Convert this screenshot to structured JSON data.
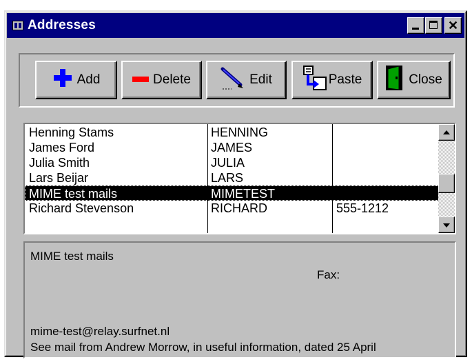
{
  "window": {
    "title": "Addresses",
    "controls": [
      "minimize",
      "maximize",
      "close"
    ]
  },
  "toolbar": {
    "add_label": "Add",
    "delete_label": "Delete",
    "edit_label": "Edit",
    "paste_label": "Paste",
    "close_label": "Close"
  },
  "list": {
    "rows": [
      {
        "name": "Henning Stams",
        "alias": "HENNING",
        "phone": ""
      },
      {
        "name": "James Ford",
        "alias": "JAMES",
        "phone": ""
      },
      {
        "name": "Julia Smith",
        "alias": "JULIA",
        "phone": ""
      },
      {
        "name": "Lars Beijar",
        "alias": "LARS",
        "phone": ""
      },
      {
        "name": "MIME test mails",
        "alias": "MIMETEST",
        "phone": ""
      },
      {
        "name": "Richard Stevenson",
        "alias": "RICHARD",
        "phone": "555-1212"
      }
    ],
    "selected_index": 4
  },
  "detail": {
    "name": "MIME test mails",
    "fax_label": "Fax:",
    "email": "mime-test@relay.surfnet.nl",
    "note": "See mail from Andrew Morrow, in useful information, dated 25 April"
  },
  "colors": {
    "titlebar": "#000080",
    "face": "#c0c0c0",
    "selection": "#000000"
  },
  "icons": {
    "add": "plus-icon",
    "delete": "minus-icon",
    "edit": "pen-icon",
    "paste": "clipboard-icon",
    "close": "door-icon"
  }
}
